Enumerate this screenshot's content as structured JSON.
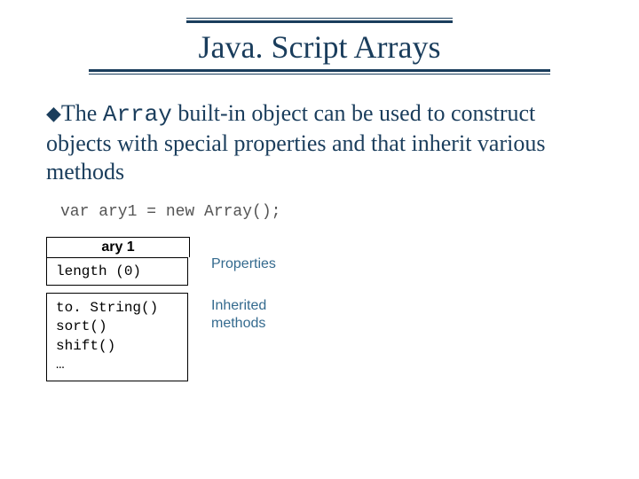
{
  "title": "Java. Script Arrays",
  "bullet_text_pre": "The ",
  "bullet_code": "Array",
  "bullet_text_post": " built-in object can be used to construct objects with special properties and that inherit various methods",
  "code_example": "var ary1 = new Array();",
  "diagram": {
    "object_name": "ary 1",
    "property_cell": "length (0)",
    "methods": [
      "to. String()",
      "sort()",
      "shift()",
      "…"
    ],
    "label_properties": "Properties",
    "label_inherited": "Inherited",
    "label_methods": "methods"
  }
}
